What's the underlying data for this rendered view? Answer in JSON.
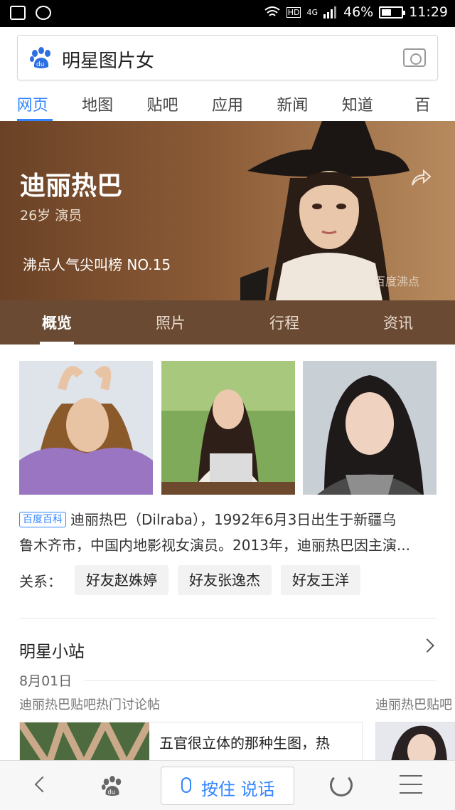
{
  "status_bar": {
    "battery": "46%",
    "time": "11:29",
    "network": "4G"
  },
  "search": {
    "query": "明星图片女"
  },
  "tabs": [
    {
      "label": "网页",
      "active": true
    },
    {
      "label": "地图"
    },
    {
      "label": "贴吧"
    },
    {
      "label": "应用"
    },
    {
      "label": "新闻"
    },
    {
      "label": "知道"
    },
    {
      "label": "百"
    }
  ],
  "profile": {
    "name": "迪丽热巴",
    "subtitle": "26岁 演员",
    "rank": "沸点人气尖叫榜 NO.15",
    "watermark": "百度沸点"
  },
  "profile_tabs": [
    {
      "label": "概览",
      "active": true
    },
    {
      "label": "照片"
    },
    {
      "label": "行程"
    },
    {
      "label": "资讯"
    }
  ],
  "intro": {
    "badge": "百度百科",
    "line1": "迪丽热巴（Dilraba），1992年6月3日出生于新疆乌",
    "line2": "鲁木齐市，中国内地影视女演员。2013年，迪丽热巴因主演..."
  },
  "relations": {
    "label": "关系：",
    "items": [
      "好友赵姝婷",
      "好友张逸杰",
      "好友王洋"
    ]
  },
  "station": {
    "title": "明星小站",
    "date": "8月01日",
    "caption_1": "迪丽热巴贴吧热门讨论帖",
    "caption_2": "迪丽热巴贴吧",
    "card_1_title": "五官很立体的那种生图，热"
  },
  "bottom_bar": {
    "voice_label": "按住 说话"
  },
  "colors": {
    "accent": "#3385ff",
    "hero_bg": "#8a5a36",
    "tab_bar_bg": "#6b4a33"
  }
}
